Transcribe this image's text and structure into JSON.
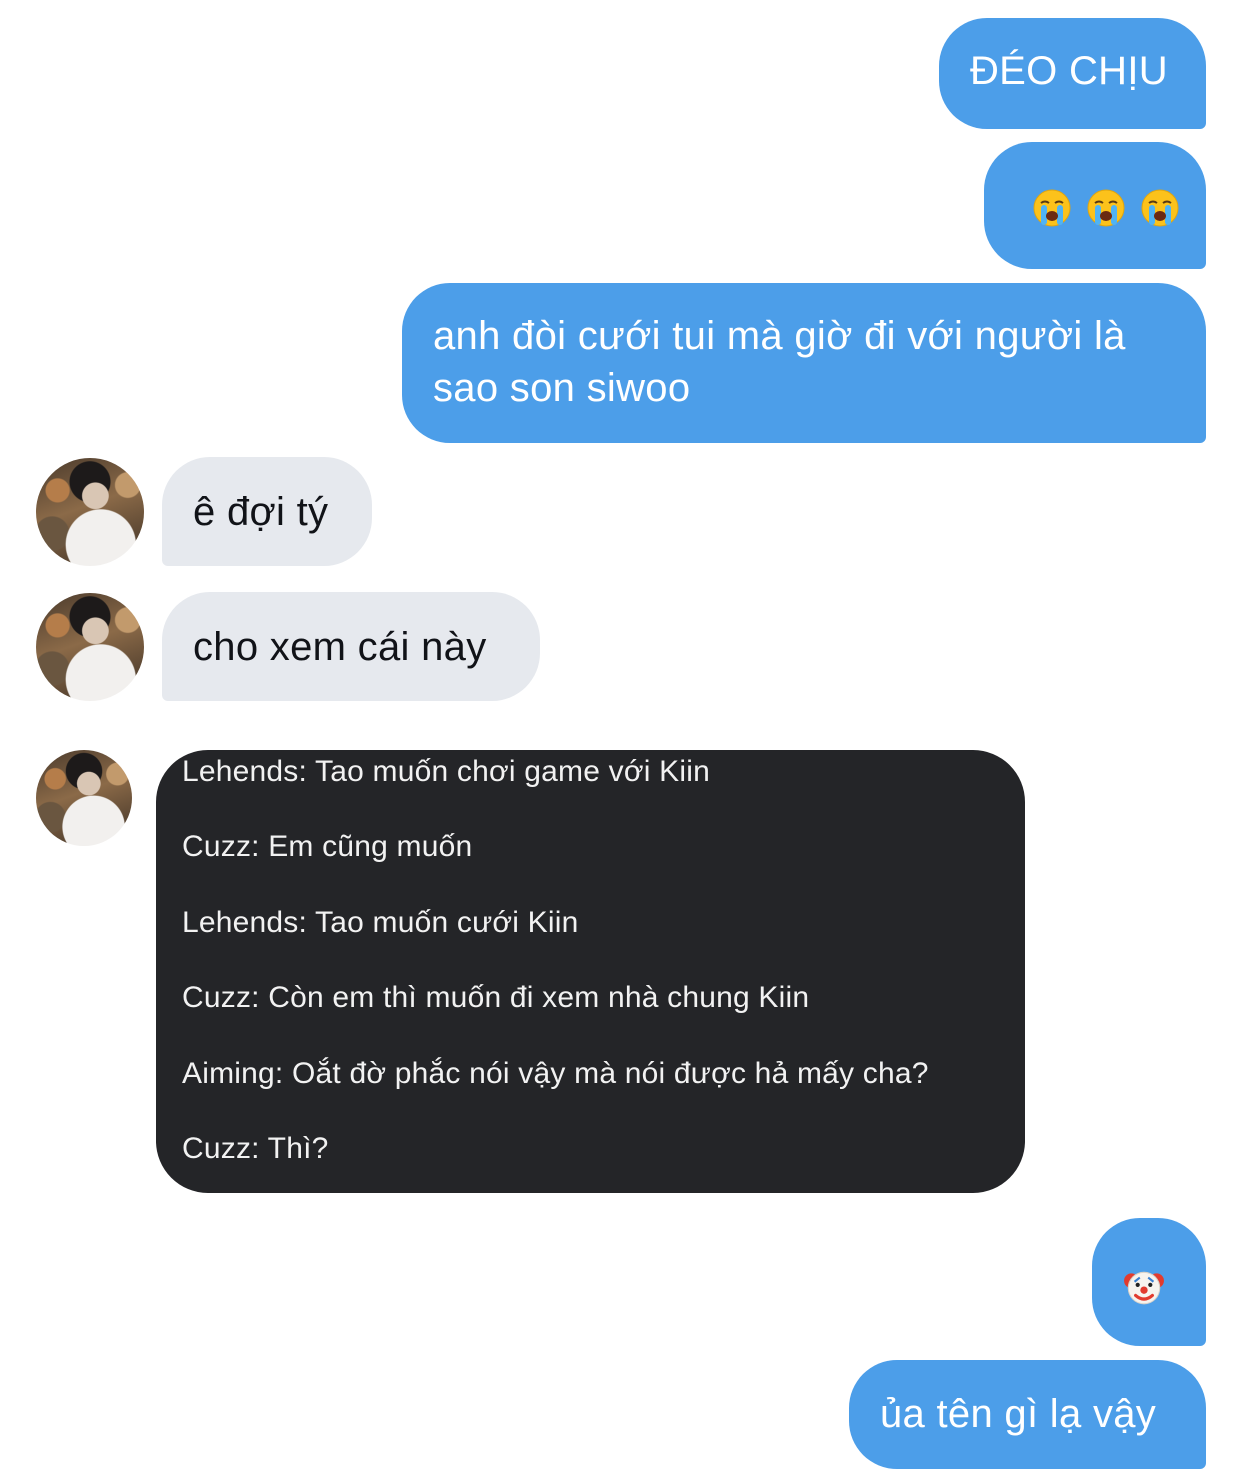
{
  "conversation": {
    "messages": [
      {
        "sender": "me",
        "text": "ĐÉO CHỊU"
      },
      {
        "sender": "me",
        "emoji": [
          "loudly-crying-face",
          "loudly-crying-face",
          "loudly-crying-face"
        ]
      },
      {
        "sender": "me",
        "text": "anh đòi cưới tui mà giờ đi với người là sao son siwoo"
      },
      {
        "sender": "them",
        "text": "ê đợi tý"
      },
      {
        "sender": "them",
        "text": "cho xem cái này"
      },
      {
        "sender": "them",
        "lines": [
          "Lehends: Tao muốn chơi game với Kiin",
          "Cuzz: Em cũng muốn",
          "Lehends: Tao muốn cưới Kiin",
          "Cuzz: Còn em thì muốn đi xem nhà chung Kiin",
          "Aiming: Oắt đờ phắc nói vậy mà nói được hả mấy cha?",
          "Cuzz: Thì?"
        ]
      },
      {
        "sender": "me",
        "emoji": [
          "clown-face"
        ]
      },
      {
        "sender": "me",
        "text": "ủa tên gì lạ vậy"
      }
    ]
  },
  "colors": {
    "outgoing_bubble": "#4c9ee9",
    "incoming_bubble": "#e6e9ee",
    "screenshot_card": "#242528",
    "background": "#ffffff"
  }
}
